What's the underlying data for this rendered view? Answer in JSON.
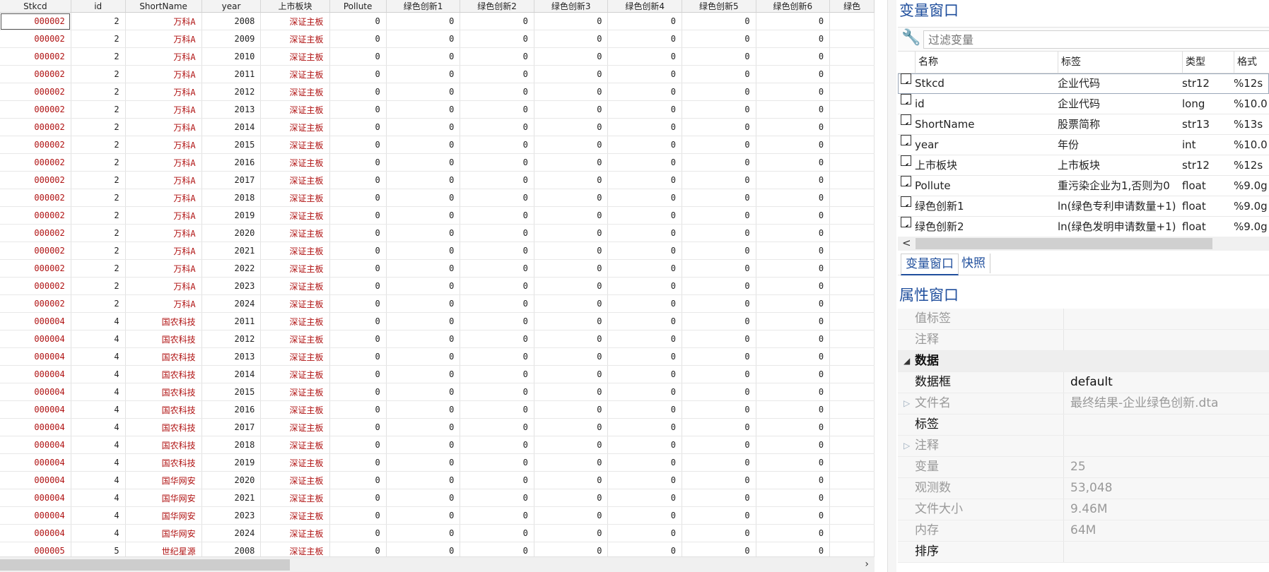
{
  "grid": {
    "columns": [
      {
        "label": "Stkcd",
        "width": 104
      },
      {
        "label": "id",
        "width": 85
      },
      {
        "label": "ShortName",
        "width": 106
      },
      {
        "label": "year",
        "width": 86
      },
      {
        "label": "上市板块",
        "width": 97
      },
      {
        "label": "Pollute",
        "width": 78
      },
      {
        "label": "绿色创新1",
        "width": 106
      },
      {
        "label": "绿色创新2",
        "width": 106
      },
      {
        "label": "绿色创新3",
        "width": 106
      },
      {
        "label": "绿色创新4",
        "width": 106
      },
      {
        "label": "绿色创新5",
        "width": 106
      },
      {
        "label": "绿色创新6",
        "width": 106
      },
      {
        "label": "绿色",
        "width": 60
      }
    ],
    "string_columns": [
      0,
      2,
      4
    ],
    "rows": [
      [
        "000002",
        "2",
        "万科A",
        "2008",
        "深证主板",
        "0",
        "0",
        "0",
        "0",
        "0",
        "0",
        "0",
        ""
      ],
      [
        "000002",
        "2",
        "万科A",
        "2009",
        "深证主板",
        "0",
        "0",
        "0",
        "0",
        "0",
        "0",
        "0",
        ""
      ],
      [
        "000002",
        "2",
        "万科A",
        "2010",
        "深证主板",
        "0",
        "0",
        "0",
        "0",
        "0",
        "0",
        "0",
        ""
      ],
      [
        "000002",
        "2",
        "万科A",
        "2011",
        "深证主板",
        "0",
        "0",
        "0",
        "0",
        "0",
        "0",
        "0",
        ""
      ],
      [
        "000002",
        "2",
        "万科A",
        "2012",
        "深证主板",
        "0",
        "0",
        "0",
        "0",
        "0",
        "0",
        "0",
        ""
      ],
      [
        "000002",
        "2",
        "万科A",
        "2013",
        "深证主板",
        "0",
        "0",
        "0",
        "0",
        "0",
        "0",
        "0",
        ""
      ],
      [
        "000002",
        "2",
        "万科A",
        "2014",
        "深证主板",
        "0",
        "0",
        "0",
        "0",
        "0",
        "0",
        "0",
        ""
      ],
      [
        "000002",
        "2",
        "万科A",
        "2015",
        "深证主板",
        "0",
        "0",
        "0",
        "0",
        "0",
        "0",
        "0",
        ""
      ],
      [
        "000002",
        "2",
        "万科A",
        "2016",
        "深证主板",
        "0",
        "0",
        "0",
        "0",
        "0",
        "0",
        "0",
        ""
      ],
      [
        "000002",
        "2",
        "万科A",
        "2017",
        "深证主板",
        "0",
        "0",
        "0",
        "0",
        "0",
        "0",
        "0",
        ""
      ],
      [
        "000002",
        "2",
        "万科A",
        "2018",
        "深证主板",
        "0",
        "0",
        "0",
        "0",
        "0",
        "0",
        "0",
        ""
      ],
      [
        "000002",
        "2",
        "万科A",
        "2019",
        "深证主板",
        "0",
        "0",
        "0",
        "0",
        "0",
        "0",
        "0",
        ""
      ],
      [
        "000002",
        "2",
        "万科A",
        "2020",
        "深证主板",
        "0",
        "0",
        "0",
        "0",
        "0",
        "0",
        "0",
        ""
      ],
      [
        "000002",
        "2",
        "万科A",
        "2021",
        "深证主板",
        "0",
        "0",
        "0",
        "0",
        "0",
        "0",
        "0",
        ""
      ],
      [
        "000002",
        "2",
        "万科A",
        "2022",
        "深证主板",
        "0",
        "0",
        "0",
        "0",
        "0",
        "0",
        "0",
        ""
      ],
      [
        "000002",
        "2",
        "万科A",
        "2023",
        "深证主板",
        "0",
        "0",
        "0",
        "0",
        "0",
        "0",
        "0",
        ""
      ],
      [
        "000002",
        "2",
        "万科A",
        "2024",
        "深证主板",
        "0",
        "0",
        "0",
        "0",
        "0",
        "0",
        "0",
        ""
      ],
      [
        "000004",
        "4",
        "国农科技",
        "2011",
        "深证主板",
        "0",
        "0",
        "0",
        "0",
        "0",
        "0",
        "0",
        ""
      ],
      [
        "000004",
        "4",
        "国农科技",
        "2012",
        "深证主板",
        "0",
        "0",
        "0",
        "0",
        "0",
        "0",
        "0",
        ""
      ],
      [
        "000004",
        "4",
        "国农科技",
        "2013",
        "深证主板",
        "0",
        "0",
        "0",
        "0",
        "0",
        "0",
        "0",
        ""
      ],
      [
        "000004",
        "4",
        "国农科技",
        "2014",
        "深证主板",
        "0",
        "0",
        "0",
        "0",
        "0",
        "0",
        "0",
        ""
      ],
      [
        "000004",
        "4",
        "国农科技",
        "2015",
        "深证主板",
        "0",
        "0",
        "0",
        "0",
        "0",
        "0",
        "0",
        ""
      ],
      [
        "000004",
        "4",
        "国农科技",
        "2016",
        "深证主板",
        "0",
        "0",
        "0",
        "0",
        "0",
        "0",
        "0",
        ""
      ],
      [
        "000004",
        "4",
        "国农科技",
        "2017",
        "深证主板",
        "0",
        "0",
        "0",
        "0",
        "0",
        "0",
        "0",
        ""
      ],
      [
        "000004",
        "4",
        "国农科技",
        "2018",
        "深证主板",
        "0",
        "0",
        "0",
        "0",
        "0",
        "0",
        "0",
        ""
      ],
      [
        "000004",
        "4",
        "国农科技",
        "2019",
        "深证主板",
        "0",
        "0",
        "0",
        "0",
        "0",
        "0",
        "0",
        ""
      ],
      [
        "000004",
        "4",
        "国华网安",
        "2020",
        "深证主板",
        "0",
        "0",
        "0",
        "0",
        "0",
        "0",
        "0",
        ""
      ],
      [
        "000004",
        "4",
        "国华网安",
        "2021",
        "深证主板",
        "0",
        "0",
        "0",
        "0",
        "0",
        "0",
        "0",
        ""
      ],
      [
        "000004",
        "4",
        "国华网安",
        "2023",
        "深证主板",
        "0",
        "0",
        "0",
        "0",
        "0",
        "0",
        "0",
        ""
      ],
      [
        "000004",
        "4",
        "国华网安",
        "2024",
        "深证主板",
        "0",
        "0",
        "0",
        "0",
        "0",
        "0",
        "0",
        ""
      ],
      [
        "000005",
        "5",
        "世纪星源",
        "2008",
        "深证主板",
        "0",
        "0",
        "0",
        "0",
        "0",
        "0",
        "0",
        ""
      ]
    ]
  },
  "variables_window": {
    "title": "变量窗口",
    "filter_placeholder": "过滤变量",
    "headers": {
      "name": "名称",
      "label": "标签",
      "type": "类型",
      "format": "格式"
    },
    "variables": [
      {
        "name": "Stkcd",
        "label": "企业代码",
        "type": "str12",
        "format": "%12s"
      },
      {
        "name": "id",
        "label": "企业代码",
        "type": "long",
        "format": "%10.0"
      },
      {
        "name": "ShortName",
        "label": "股票简称",
        "type": "str13",
        "format": "%13s"
      },
      {
        "name": "year",
        "label": "年份",
        "type": "int",
        "format": "%10.0"
      },
      {
        "name": "上市板块",
        "label": "上市板块",
        "type": "str12",
        "format": "%12s"
      },
      {
        "name": "Pollute",
        "label": "重污染企业为1,否则为0",
        "type": "float",
        "format": "%9.0g"
      },
      {
        "name": "绿色创新1",
        "label": "ln(绿色专利申请数量+1)",
        "type": "float",
        "format": "%9.0g"
      },
      {
        "name": "绿色创新2",
        "label": "ln(绿色发明申请数量+1)",
        "type": "float",
        "format": "%9.0g"
      }
    ]
  },
  "tabs": {
    "variables": "变量窗口",
    "snapshots": "快照"
  },
  "properties_window": {
    "title": "属性窗口",
    "rows": [
      {
        "key": "值标签",
        "value": "",
        "style": "dim"
      },
      {
        "key": "注释",
        "value": "",
        "style": "dim"
      },
      {
        "key": "数据",
        "value": "",
        "style": "section"
      },
      {
        "key": "数据框",
        "value": "default",
        "style": "strong"
      },
      {
        "key": "文件名",
        "value": "最终结果-企业绿色创新.dta",
        "style": "dim",
        "expander": true
      },
      {
        "key": "标签",
        "value": "",
        "style": "strong"
      },
      {
        "key": "注释",
        "value": "",
        "style": "dim",
        "expander": true
      },
      {
        "key": "变量",
        "value": "25",
        "style": "dim"
      },
      {
        "key": "观测数",
        "value": "53,048",
        "style": "dim"
      },
      {
        "key": "文件大小",
        "value": "9.46M",
        "style": "dim"
      },
      {
        "key": "内存",
        "value": "64M",
        "style": "dim"
      },
      {
        "key": "排序",
        "value": "",
        "style": "strong"
      }
    ]
  },
  "icons": {
    "filter": "wrench-icon",
    "scroll_down": "chevron-down-icon",
    "scroll_right": "chevron-right-icon",
    "scroll_left": "chevron-left-icon",
    "check": "checkmark-icon",
    "collapse": "triangle-down-icon",
    "expand": "triangle-right-icon"
  }
}
